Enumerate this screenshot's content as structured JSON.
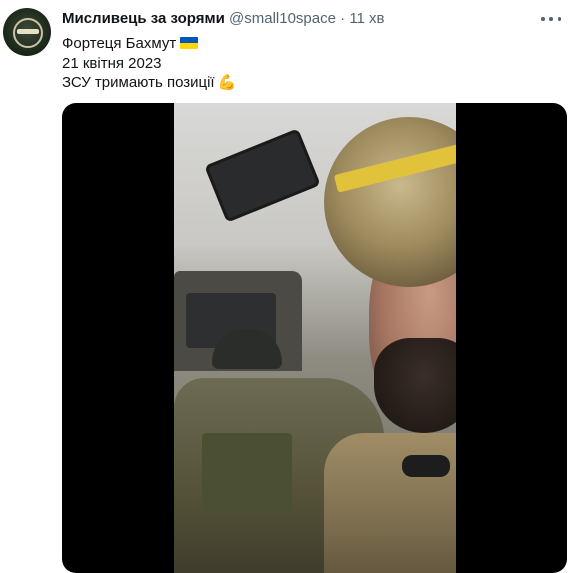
{
  "tweet": {
    "author_name": "Мисливець за зорями",
    "author_handle": "@small10space",
    "separator": "·",
    "time": "11 хв",
    "lines": [
      "Фортеця Бахмут",
      "21 квітня 2023",
      "ЗСУ тримають позиції"
    ],
    "emoji": {
      "line1": "ukraine-flag",
      "line3": "flexed-biceps"
    }
  },
  "colors": {
    "text_primary": "#0f1419",
    "text_secondary": "#536471",
    "flag_blue": "#0057b7",
    "flag_yellow": "#ffd700",
    "media_background": "#000000"
  }
}
